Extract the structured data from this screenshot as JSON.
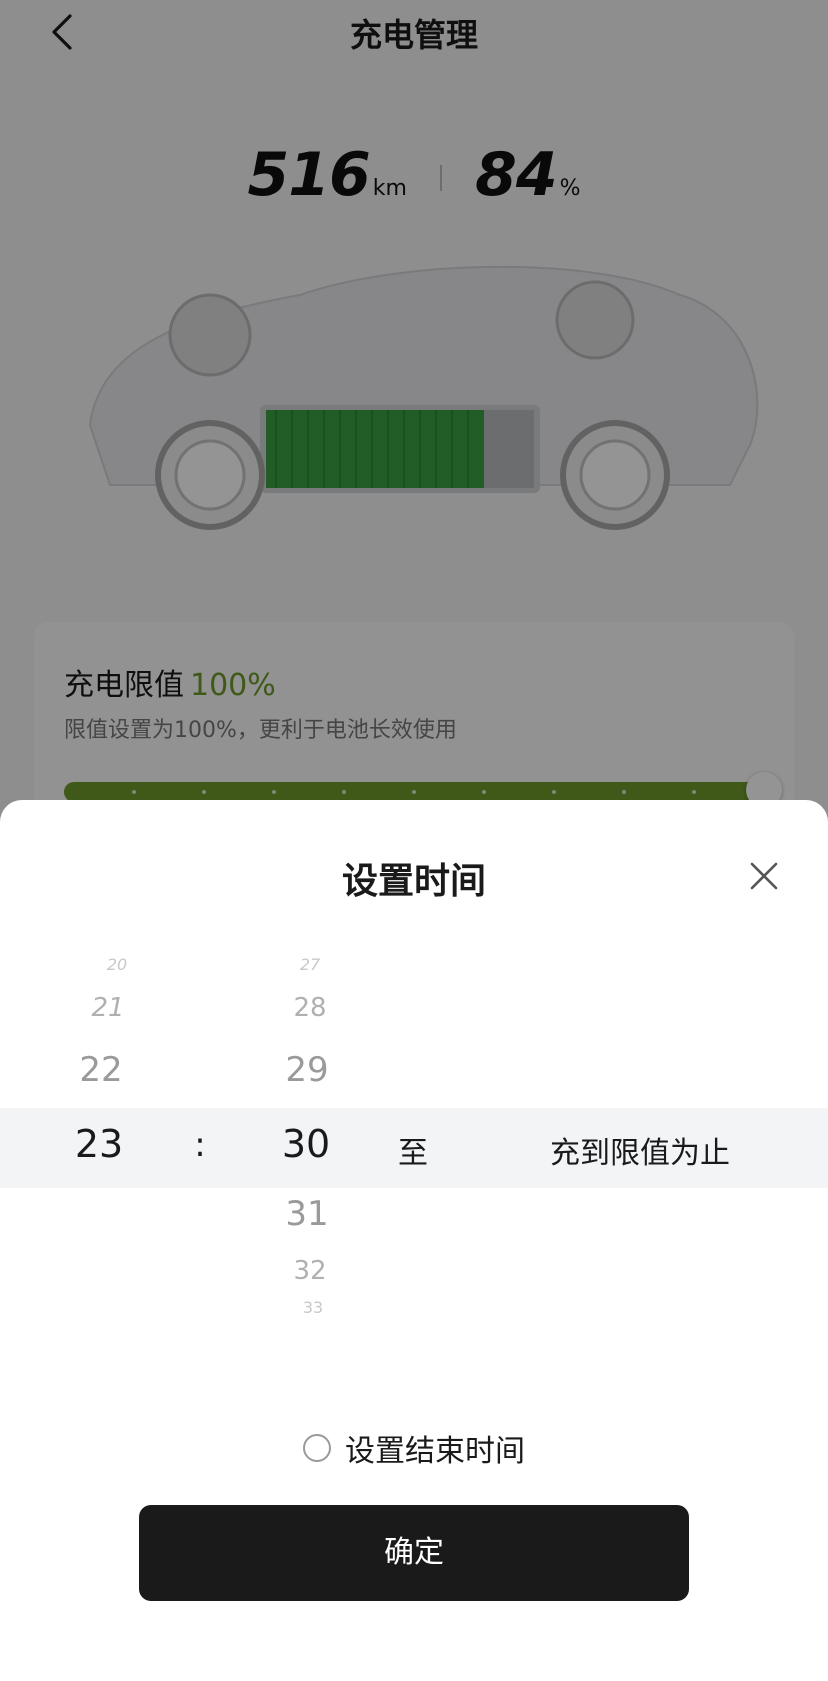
{
  "header": {
    "title": "充电管理"
  },
  "stats": {
    "range_value": "516",
    "range_unit": "km",
    "battery_value": "84",
    "battery_unit": "%"
  },
  "charge_limit": {
    "label": "充电限值",
    "value": "100%",
    "description": "限值设置为100%，更利于电池长效使用",
    "slider_level": 1.0
  },
  "sheet": {
    "title": "设置时间",
    "picker": {
      "hours": [
        "20",
        "21",
        "22",
        "23",
        "",
        ""
      ],
      "minutes": [
        "27",
        "28",
        "29",
        "30",
        "31",
        "32",
        "33"
      ],
      "separator": ":",
      "to_label": "至",
      "until_label": "充到限值为止"
    },
    "end_time_option": {
      "label": "设置结束时间",
      "checked": false
    },
    "confirm_label": "确定"
  },
  "colors": {
    "accent_green": "#6e9a2c",
    "button_dark": "#1a1a1a"
  }
}
